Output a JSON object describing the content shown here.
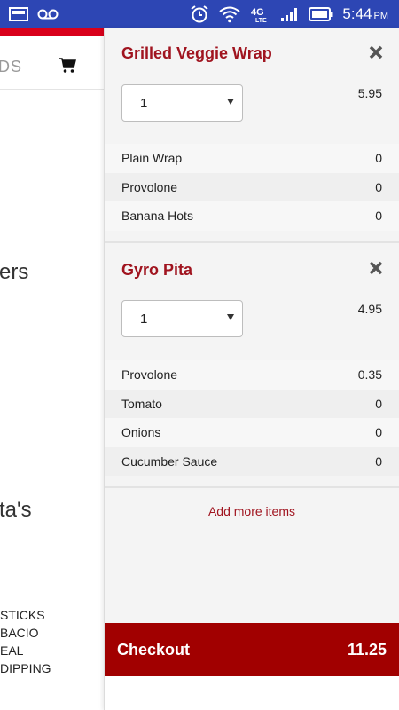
{
  "status_bar": {
    "time": "5:44",
    "ampm": "PM",
    "network": "4G LTE"
  },
  "background_page": {
    "nav_text": "DS",
    "heading_1": "ers",
    "heading_2": "ta's",
    "list": [
      "STICKS",
      "BACIO",
      "EAL",
      "DIPPING"
    ],
    "accent_color": "#d9001b"
  },
  "cart": {
    "items": [
      {
        "title": "Grilled Veggie Wrap",
        "quantity": "1",
        "price": "5.95",
        "options": [
          {
            "name": "Plain Wrap",
            "price": "0"
          },
          {
            "name": "Provolone",
            "price": "0"
          },
          {
            "name": "Banana Hots",
            "price": "0"
          }
        ]
      },
      {
        "title": "Gyro Pita",
        "quantity": "1",
        "price": "4.95",
        "options": [
          {
            "name": "Provolone",
            "price": "0.35"
          },
          {
            "name": "Tomato",
            "price": "0"
          },
          {
            "name": "Onions",
            "price": "0"
          },
          {
            "name": "Cucumber Sauce",
            "price": "0"
          }
        ]
      }
    ],
    "add_more_label": "Add more items",
    "checkout_label": "Checkout",
    "total": "11.25",
    "brand_color": "#a10000"
  }
}
